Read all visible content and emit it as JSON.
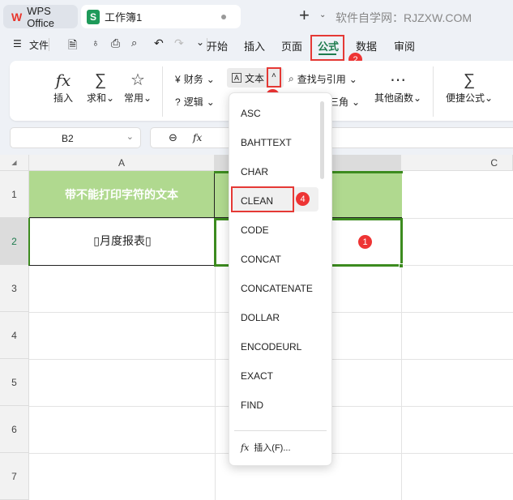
{
  "titlebar": {
    "app_tab": "WPS Office",
    "doc_tab": "工作簿1",
    "new_tab": "+",
    "watermark": "软件自学网：RJZXW.COM"
  },
  "menubar": {
    "file": "文件",
    "tabs": [
      "开始",
      "插入",
      "页面",
      "公式",
      "数据",
      "审阅"
    ],
    "active_tab": "公式"
  },
  "ribbon": {
    "insert": "插入",
    "sum": "求和",
    "common": "常用",
    "finance": "财务",
    "text": "文本",
    "lookup": "查找与引用",
    "logic": "逻辑",
    "trig": "三角",
    "other": "其他函数",
    "quick": "便捷公式"
  },
  "formula_bar": {
    "name_box": "B2",
    "fx": "fx"
  },
  "grid": {
    "columns": [
      "A",
      "",
      "C"
    ],
    "rows": [
      "1",
      "2",
      "3",
      "4",
      "5",
      "6",
      "7"
    ],
    "a1": "带不能打印字符的文本",
    "a2": "▯月度报表▯"
  },
  "dropdown": {
    "items": [
      "ASC",
      "BAHTTEXT",
      "CHAR",
      "CLEAN",
      "CODE",
      "CONCAT",
      "CONCATENATE",
      "DOLLAR",
      "ENCODEURL",
      "EXACT",
      "FIND"
    ],
    "highlighted": "CLEAN",
    "insert_function": "插入(F)..."
  },
  "annotations": [
    "1",
    "2",
    "3",
    "4"
  ],
  "colors": {
    "accent": "#1e7b4d",
    "header_fill": "#b0d98f",
    "selection": "#3c8b1f",
    "marker": "#e53935"
  }
}
